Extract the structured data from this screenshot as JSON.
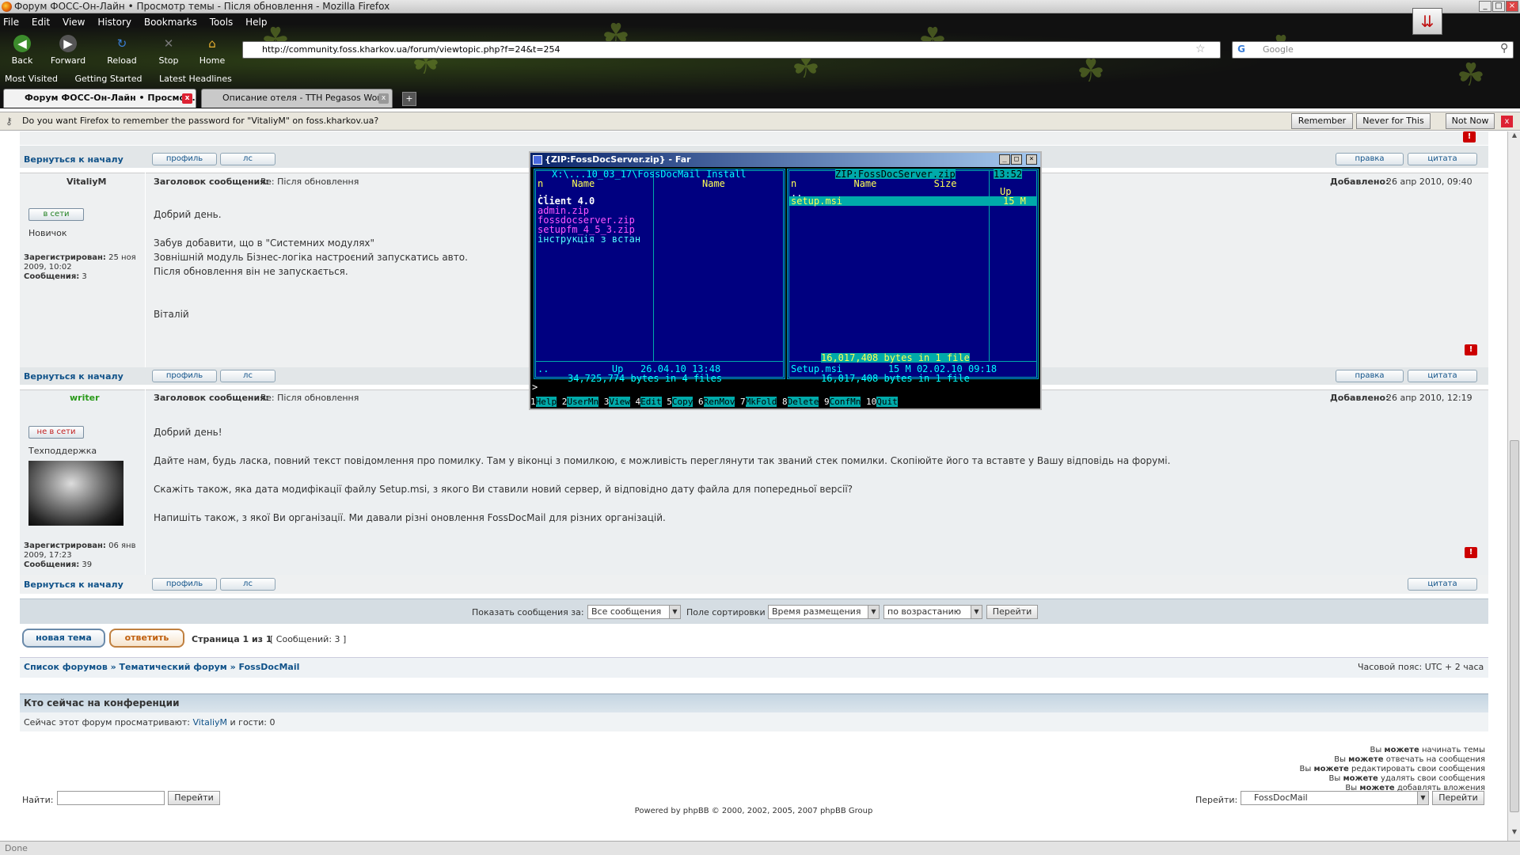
{
  "window": {
    "title": "Форум ФОСС-Он-Лайн • Просмотр темы - Після обновлення - Mozilla Firefox"
  },
  "menu": [
    "File",
    "Edit",
    "View",
    "History",
    "Bookmarks",
    "Tools",
    "Help"
  ],
  "nav": {
    "back": "Back",
    "forward": "Forward",
    "reload": "Reload",
    "stop": "Stop",
    "home": "Home"
  },
  "url": "http://community.foss.kharkov.ua/forum/viewtopic.php?f=24&t=254",
  "search_placeholder": "Google",
  "bookmarks": [
    "Most Visited",
    "Getting Started",
    "Latest Headlines"
  ],
  "tabs": [
    {
      "label": "Форум ФОСС-Он-Лайн • Просмо..."
    },
    {
      "label": "Описание отеля - TTH Pegasos World ..."
    }
  ],
  "notification": {
    "text": "Do you want Firefox to remember the password for \"VitaliyM\" on foss.kharkov.ua?",
    "remember": "Remember",
    "never": "Never for This Site",
    "notnow": "Not Now"
  },
  "forum": {
    "back_to_top": "Вернуться к началу",
    "profile": "профиль",
    "pm": "лс",
    "edit": "правка",
    "quote": "цитата",
    "subject_label": "Заголовок сообщения:",
    "added_label": "Добавлено:",
    "registered_label": "Зарегистрирован:",
    "posts_label": "Сообщения:",
    "posts": [
      {
        "author": "VitaliyM",
        "status": "в сети",
        "rank": "Новичок",
        "subject": "Re: Після обновлення",
        "date": "26 апр 2010, 09:40",
        "registered": "25 ноя 2009, 10:02",
        "count": "3",
        "lines": [
          "Добрий день.",
          "",
          "Забув добавити, що в \"Системних модулях\"",
          "Зовнішній модуль Бізнес-логіка настроєний запускатись авто.",
          "Після обновлення він не запускається.",
          "",
          "",
          "Віталій"
        ]
      },
      {
        "author": "writer",
        "status": "не в сети",
        "rank": "Техподдержка",
        "subject": "Re: Після обновлення",
        "date": "26 апр 2010, 12:19",
        "registered": "06 янв 2009, 17:23",
        "count": "39",
        "lines": [
          "Добрий день!",
          "",
          "Дайте нам, будь ласка, повний текст повідомлення про помилку. Там у віконці з помилкою, є можливість переглянути так званий стек помилки. Скопіюйте його та вставте у Вашу відповідь на форумі.",
          "",
          "Скажіть також, яка дата модифікації файлу Setup.msi, з якого Ви ставили новий сервер, й відповідно дату файла для попередньої версії?",
          "",
          "Напишіть також, з якої Ви організації. Ми давали різні оновлення FossDocMail для різних організацій."
        ]
      }
    ],
    "show_label": "Показать сообщения за:",
    "show_value": "Все сообщения",
    "sort_label": "Поле сортировки",
    "sort_value": "Время размещения",
    "order_value": "по возрастанию",
    "go": "Перейти",
    "new_topic": "новая тема",
    "reply": "ответить",
    "page_info": "Страница 1 из 1",
    "msg_count": "[ Сообщений: 3 ]",
    "breadcrumb": [
      "Список форумов",
      "Тематический форум",
      "FossDocMail"
    ],
    "timezone": "Часовой пояс: UTC + 2 часа",
    "who_title": "Кто сейчас на конференции",
    "who_prefix": "Сейчас этот форум просматривают:",
    "who_user": "VitaliyM",
    "who_suffix": "и гости: 0",
    "perms": [
      "Вы можете начинать темы",
      "Вы можете отвечать на сообщения",
      "Вы можете редактировать свои сообщения",
      "Вы можете удалять свои сообщения",
      "Вы можете добавлять вложения"
    ],
    "find_label": "Найти:",
    "jump_label": "Перейти:",
    "jump_value": "FossDocMail",
    "footer": "Powered by phpBB © 2000, 2002, 2005, 2007 phpBB Group"
  },
  "far": {
    "title": "{ZIP:FossDocServer.zip} - Far",
    "left_path": "X:\\...10_03_17\\FossDocMail Install",
    "left_col1": "n     Name",
    "left_col2": "Name",
    "left_files": [
      "..",
      "Client 4.0",
      "admin.zip",
      "fossdocserver.zip",
      "setupfm_4_5_3.zip",
      "інструкція з встан"
    ],
    "left_status1": "..           Up   26.04.10 13:48",
    "left_status2": "34,725,774 bytes in 4 files",
    "right_path": "ZIP:FossDocServer.zip",
    "clock": "13:52",
    "right_col": "n          Name          Size",
    "right_col_b": "Up",
    "right_files": [
      "..",
      "setup.msi"
    ],
    "right_size": "15 M",
    "right_info": "16,017,408 bytes in 1 file",
    "right_status1": "Setup.msi        15 M 02.02.10 09:18",
    "right_status2": "16,017,408 bytes in 1 file",
    "prompt": ">",
    "keys": [
      [
        "1",
        "Help"
      ],
      [
        "2",
        "UserMn"
      ],
      [
        "3",
        "View"
      ],
      [
        "4",
        "Edit"
      ],
      [
        "5",
        "Copy"
      ],
      [
        "6",
        "RenMov"
      ],
      [
        "7",
        "MkFold"
      ],
      [
        "8",
        "Delete"
      ],
      [
        "9",
        "ConfMn"
      ],
      [
        "10",
        "Quit"
      ]
    ]
  },
  "status": "Done"
}
